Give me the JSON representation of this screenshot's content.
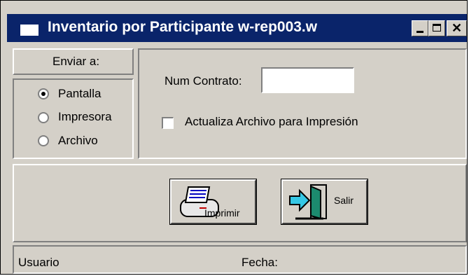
{
  "window": {
    "title": "Inventario por Participante w-rep003.w",
    "controls": {
      "minimize": "minimize",
      "maximize": "maximize",
      "close": "close"
    }
  },
  "send_to": {
    "label": "Enviar a:",
    "options": [
      {
        "label": "Pantalla",
        "checked": true
      },
      {
        "label": "Impresora",
        "checked": false
      },
      {
        "label": "Archivo",
        "checked": false
      }
    ]
  },
  "form": {
    "contract_label": "Num Contrato:",
    "contract_value": "",
    "update_file_label": "Actualiza Archivo para Impresión",
    "update_file_checked": false
  },
  "buttons": {
    "print_label": "Imprimir",
    "exit_label": "Salir"
  },
  "status": {
    "user_label": "Usuario",
    "date_label": "Fecha:"
  },
  "colors": {
    "titlebar": "#0a246a",
    "face": "#d4d0c8"
  },
  "icons": {
    "window": "window-icon",
    "print": "printer-icon",
    "exit": "exit-door-icon"
  }
}
